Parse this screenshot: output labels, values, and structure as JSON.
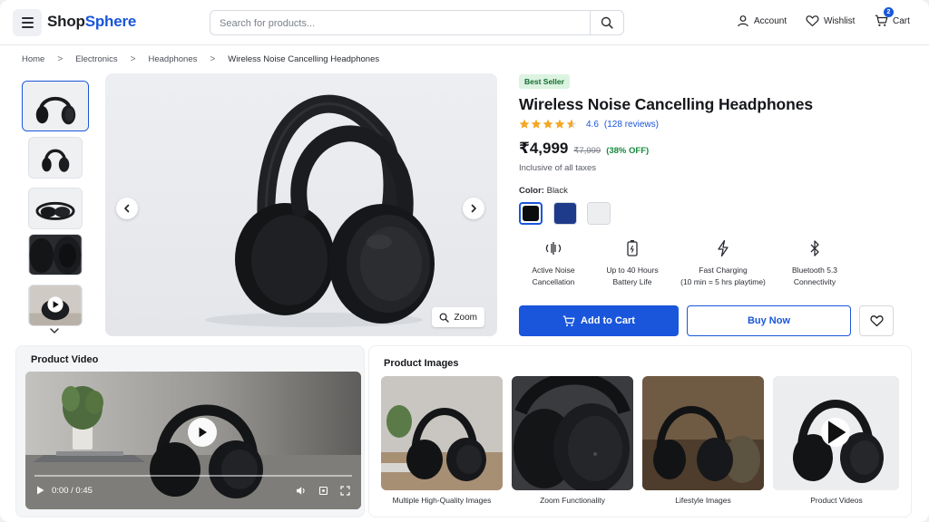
{
  "header": {
    "logo_part1": "Shop",
    "logo_part2": "Sphere",
    "search_placeholder": "Search for products...",
    "account_label": "Account",
    "wishlist_label": "Wishlist",
    "cart_label": "Cart",
    "cart_count": "2"
  },
  "breadcrumb": {
    "items": [
      "Home",
      "Electronics",
      "Headphones",
      "Wireless Noise Cancelling Headphones"
    ]
  },
  "gallery": {
    "zoom_label": "Zoom"
  },
  "product": {
    "badge": "Best Seller",
    "title": "Wireless Noise Cancelling Headphones",
    "rating": "4.6",
    "rating_value": 4.6,
    "reviews": "(128 reviews)",
    "price": "₹4,999",
    "mrp": "₹7,999",
    "discount": "(38% OFF)",
    "tax_note": "Inclusive of all taxes",
    "color_label": "Color:",
    "color_value": "Black",
    "colors": [
      "#0b0c0e",
      "#1e3a8a",
      "#eceef0"
    ],
    "features": [
      {
        "line1": "Active Noise",
        "line2": "Cancellation",
        "icon": "noise-cancel-icon"
      },
      {
        "line1": "Up to 40 Hours",
        "line2": "Battery Life",
        "icon": "battery-icon"
      },
      {
        "line1": "Fast Charging",
        "line2": "(10 min = 5 hrs playtime)",
        "icon": "lightning-icon"
      },
      {
        "line1": "Bluetooth 5.3",
        "line2": "Connectivity",
        "icon": "bluetooth-icon"
      }
    ],
    "add_to_cart": "Add to Cart",
    "buy_now": "Buy Now"
  },
  "video_panel": {
    "title": "Product Video",
    "time": "0:00 / 0:45",
    "progress": 0.0
  },
  "images_panel": {
    "title": "Product Images",
    "cards": [
      "Multiple High-Quality Images",
      "Zoom Functionality",
      "Lifestyle Images",
      "Product Videos"
    ]
  },
  "colors": {
    "accent": "#1a56db",
    "star": "#f5a623",
    "success": "#168a3b"
  }
}
